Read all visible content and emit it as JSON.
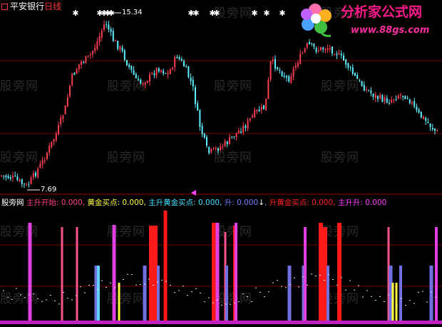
{
  "title": {
    "stock_name": "平安银行",
    "period": "日线",
    "stock_color": "#ffffff",
    "period_color": "#ff3030"
  },
  "price_panel": {
    "high_label": "15.34",
    "low_label": "7.69"
  },
  "indicator": {
    "name": "股旁网",
    "items": [
      {
        "label": "主升开始:",
        "value": "0.000",
        "color": "#ff3a8a"
      },
      {
        "label": "黄金买点:",
        "value": "0.000",
        "color": "#ffff40"
      },
      {
        "label": "主升黄金买点:",
        "value": "0.000",
        "color": "#40e0ff"
      },
      {
        "label": "升:",
        "value": "0.000",
        "color": "#7080ff",
        "arrow": "↓"
      },
      {
        "label": "升黄金买点:",
        "value": "0.000",
        "color": "#ff2020"
      },
      {
        "label": "主升升:",
        "value": "0.000",
        "color": "#ff40ff"
      }
    ]
  },
  "watermark": {
    "text": "股旁网"
  },
  "logo": {
    "title": "分析家公式网",
    "url": "www.88gs.com"
  },
  "colors": {
    "up": "#ff4050",
    "down": "#5ff0ff",
    "grid": "#8a0000",
    "bg": "#000000"
  },
  "icons": {
    "buy_marker": "star-icon",
    "cursor_marker": "triangle-left-icon"
  }
}
